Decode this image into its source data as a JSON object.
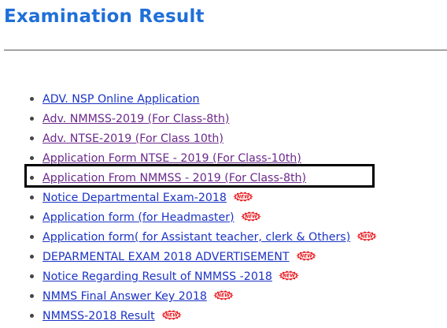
{
  "header": {
    "title": "Examination Result"
  },
  "badge": {
    "text": "NEW",
    "color": "#e8151b"
  },
  "colors": {
    "title": "#1f6fd8",
    "link": "#1c34c4",
    "visited": "#6b2a8c",
    "highlight": "#000000"
  },
  "links": [
    {
      "label": "ADV. NSP Online Application",
      "visited": false,
      "is_new": false
    },
    {
      "label": "Adv. NMMSS-2019 (For Class-8th)",
      "visited": true,
      "is_new": false
    },
    {
      "label": "Adv. NTSE-2019 (For Class 10th)",
      "visited": true,
      "is_new": false
    },
    {
      "label": "Application Form NTSE - 2019 (For Class-10th)",
      "visited": true,
      "is_new": false
    },
    {
      "label": "Application From NMMSS - 2019 (For Class-8th)",
      "visited": true,
      "is_new": false,
      "highlighted": true
    },
    {
      "label": "Notice Departmental Exam-2018",
      "visited": false,
      "is_new": true
    },
    {
      "label": "Application form  (for Headmaster)",
      "visited": false,
      "is_new": true
    },
    {
      "label": "Application form( for Assistant teacher, clerk & Others)",
      "visited": false,
      "is_new": true
    },
    {
      "label": "DEPARMENTAL EXAM 2018 ADVERTISEMENT",
      "visited": false,
      "is_new": true
    },
    {
      "label": "Notice Regarding Result of NMMSS -2018",
      "visited": false,
      "is_new": true
    },
    {
      "label": "NMMS Final Answer Key 2018",
      "visited": false,
      "is_new": true
    },
    {
      "label": "NMMSS-2018 Result",
      "visited": false,
      "is_new": true
    }
  ]
}
